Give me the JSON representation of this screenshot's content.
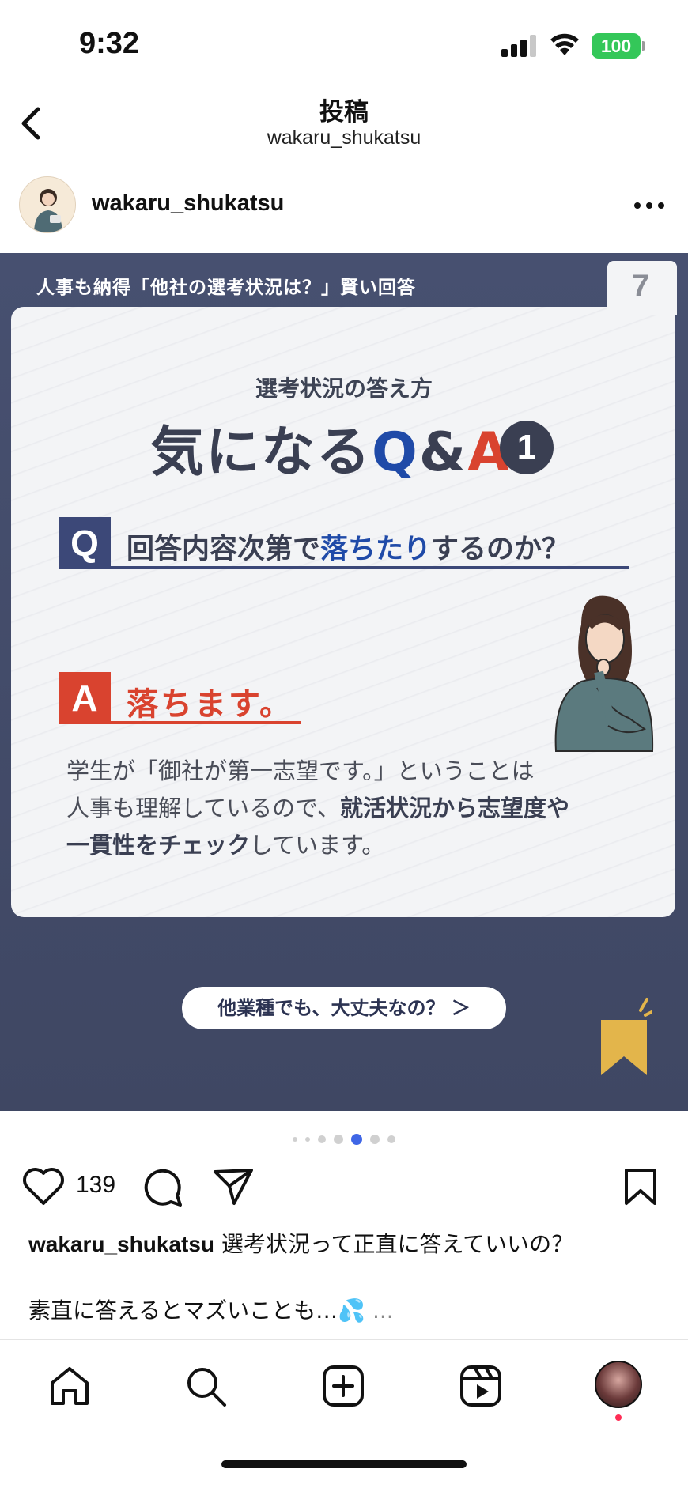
{
  "status_bar": {
    "time": "9:32",
    "battery": "100"
  },
  "header": {
    "title": "投稿",
    "subtitle": "wakaru_shukatsu"
  },
  "post": {
    "username": "wakaru_shukatsu"
  },
  "slide": {
    "top_banner": "人事も納得「他社の選考状況は？」賢い回答",
    "page_number": "7",
    "subtitle": "選考状況の答え方",
    "title_main": "気になる",
    "title_q": "Q",
    "title_amp": "&",
    "title_a": "A",
    "title_num": "1",
    "q_badge": "Q",
    "q_text_1": "回答内容次第で",
    "q_text_em": "落ちたり",
    "q_text_2": "するのか？",
    "a_badge": "A",
    "a_text": "落ちます。",
    "body_line1": "学生が「御社が第一志望です。」ということは",
    "body_line2_a": "人事も理解しているので、",
    "body_line2_b": "就活状況から志望度や",
    "body_line3_a": "一貫性をチェック",
    "body_line3_b": "しています。",
    "next_button": "他業種でも、大丈夫なの？ ＞"
  },
  "carousel": {
    "total": 7,
    "active_index": 4
  },
  "actions": {
    "like_count": "139"
  },
  "caption": {
    "username": "wakaru_shukatsu",
    "text": "選考状況って正直に答えていいの？",
    "line2": "素直に答えるとマズいことも…💦",
    "more": "..."
  },
  "colors": {
    "accent_blue": "#1f4aa8",
    "accent_red": "#d9432f",
    "slide_bg": "#454d6c",
    "battery_green": "#34c759"
  },
  "icons": [
    "back-icon",
    "more-icon",
    "heart-icon",
    "comment-icon",
    "share-icon",
    "bookmark-icon",
    "home-icon",
    "search-icon",
    "add-icon",
    "reels-icon"
  ]
}
